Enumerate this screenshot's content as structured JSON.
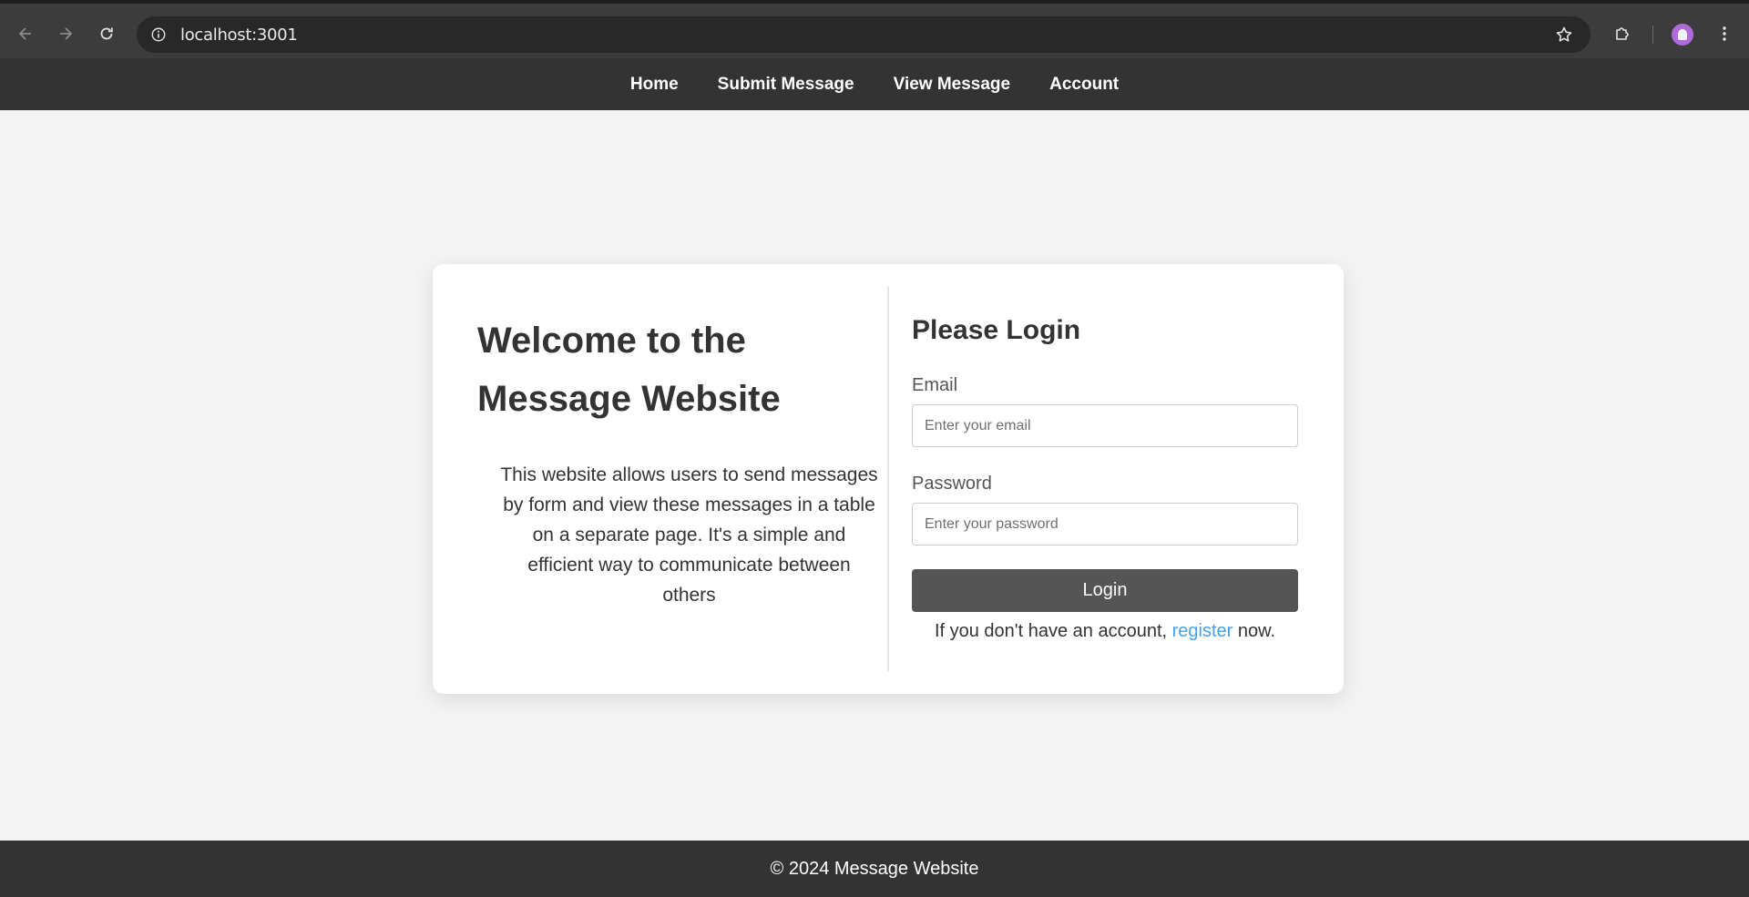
{
  "browser": {
    "url": "localhost:3001",
    "icons": [
      "back-arrow-icon",
      "forward-arrow-icon",
      "reload-icon",
      "site-info-icon",
      "bookmark-star-icon",
      "extensions-puzzle-icon",
      "profile-avatar-icon",
      "menu-kebab-icon"
    ]
  },
  "nav": {
    "items": [
      {
        "label": "Home"
      },
      {
        "label": "Submit Message"
      },
      {
        "label": "View Message"
      },
      {
        "label": "Account"
      }
    ]
  },
  "welcome": {
    "title": "Welcome to the Message Website",
    "description": "This website allows users to send messages by form and view these messages in a table on a separate page. It's a simple and efficient way to communicate between others"
  },
  "login": {
    "title": "Please Login",
    "email_label": "Email",
    "email_placeholder": "Enter your email",
    "email_value": "",
    "password_label": "Password",
    "password_placeholder": "Enter your password",
    "password_value": "",
    "button_label": "Login",
    "register_prefix": "If you don't have an account, ",
    "register_link": "register",
    "register_suffix": " now."
  },
  "footer": {
    "text": "© 2024 Message Website"
  },
  "colors": {
    "nav_bg": "#333333",
    "page_bg": "#f3f3f3",
    "button_bg": "#555555",
    "link": "#4a9fe6"
  }
}
